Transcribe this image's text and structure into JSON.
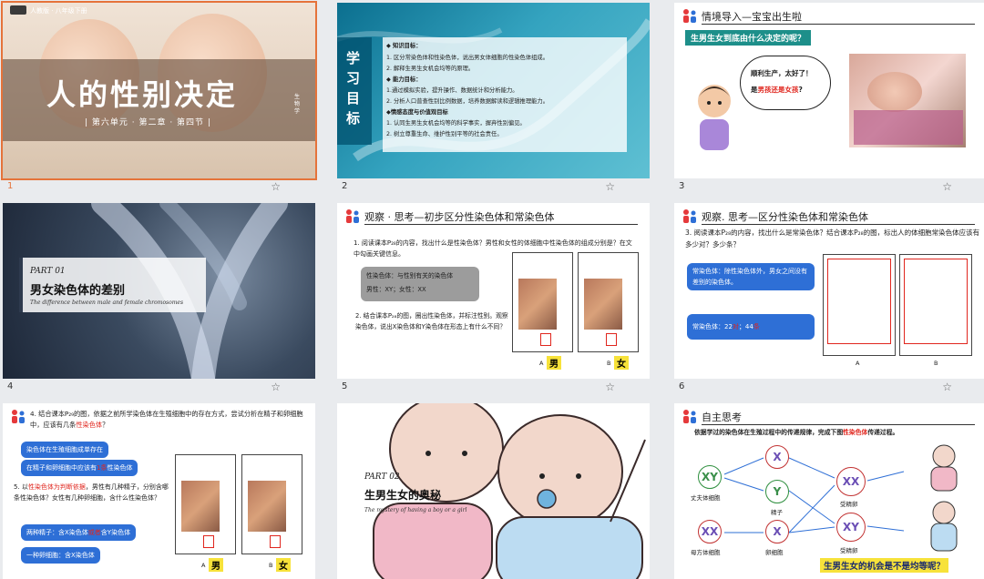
{
  "slides": [
    {
      "num": "1",
      "title": "人的性别决定",
      "subtitle": "| 第六单元 · 第二章 · 第四节 |",
      "brand": "人教版 · 八年级下册",
      "vertical": "生物学"
    },
    {
      "num": "2",
      "side": "学习目标",
      "lines": [
        {
          "text": "◆ 知识目标：",
          "bold": true
        },
        {
          "text": "1. 区分常染色体和性染色体，说出男女体细胞的性染色体组成。"
        },
        {
          "text": "2. 解释生男生女机会均等的原理。"
        },
        {
          "text": "◆ 能力目标：",
          "bold": true
        },
        {
          "text": "1.通过模拟实验，提升操作、数据统计和分析能力。"
        },
        {
          "text": "2. 分析人口普查性别比例数据，培养数据解读和逻辑推理能力。"
        },
        {
          "text": "◆情感态度与价值观目标",
          "bold": true
        },
        {
          "text": "1. 认同生男生女机会均等的科学事实，摒弃性别偏见。"
        },
        {
          "text": "2. 树立尊重生命、维护性别平等的社会责任。"
        }
      ]
    },
    {
      "num": "3",
      "header": "情境导入—宝宝出生啦",
      "question": "生男生女到底由什么决定的呢？",
      "bubble1": "顺利生产，太好了！",
      "bubble2a": "是",
      "bubble2b": "男孩还是女孩",
      "bubble2c": "?"
    },
    {
      "num": "4",
      "part": "PART 01",
      "title": "男女染色体的差别",
      "en": "The difference between male and female chromosomes"
    },
    {
      "num": "5",
      "header": "观察 · 思考—初步区分性染色体和常染色体",
      "q1": "1. 阅读课本P₂₈的内容，找出什么是性染色体？男性和女性的体细胞中性染色体的组成分别是？在文中勾画关键信息。",
      "ans1": "性染色体：与性别有关的染色体",
      "ans2": "男性：XY；女性：XX",
      "q2": "2. 结合课本P₂₈的图，圈出性染色体，并标注性别。观察染色体，说出X染色体和Y染色体在形态上有什么不同？",
      "labelA": "A",
      "labelB": "B",
      "male": "男",
      "female": "女"
    },
    {
      "num": "6",
      "header": "观察. 思考—区分性染色体和常染色体",
      "q": "3. 阅读课本P₂₈的内容，找出什么是常染色体？结合课本P₂₈的图，标出人的体细胞常染色体应该有多少对？多少条？",
      "ans1": "常染色体：除性染色体外，男女之间没有差别的染色体。",
      "ans2a": "常染色体：22",
      "ans2b": "对",
      "ans2c": "；44",
      "ans2d": "条",
      "labelA": "A",
      "labelB": "B"
    },
    {
      "num": "",
      "q4a": "4. 结合课本P₂₉的图，依据之前所学染色体在生殖细胞中的存在方式，尝试分析在精子和卵细胞中，应该有几条",
      "q4b": "性染色体",
      "q4c": "？",
      "p1": "染色体在生殖细胞成单存在",
      "p2a": "在精子和卵细胞中应该有",
      "p2b": "1条",
      "p2c": "性染色体",
      "q5a": "5. 以",
      "q5b": "性染色体为判断依据",
      "q5c": "，男性有几种精子，分别含哪条性染色体？女性有几种卵细胞，含什么性染色体？",
      "p3a": "两种精子：含X染色体",
      "p3b": "或者",
      "p3c": "含Y染色体",
      "p4": "一种卵细胞：含X染色体",
      "labelA": "A",
      "labelB": "B",
      "male": "男",
      "female": "女"
    },
    {
      "num": "",
      "part": "PART 02",
      "title": "生男生女的奥秘",
      "en": "The mystery of having a boy or a girl"
    },
    {
      "num": "",
      "header": "自主思考",
      "q1": "依据学过的染色体在生殖过程中的传递规律，完成下图",
      "q2": "性染色体",
      "q3": "传递过程。",
      "l_father": "丈夫体细胞",
      "l_mother": "母方体细胞",
      "l_sperm": "精子",
      "l_egg": "卵细胞",
      "l_zygote1": "受精卵",
      "l_zygote2": "受精卵",
      "bottom": "生男生女的机会是不是均等呢？"
    }
  ]
}
